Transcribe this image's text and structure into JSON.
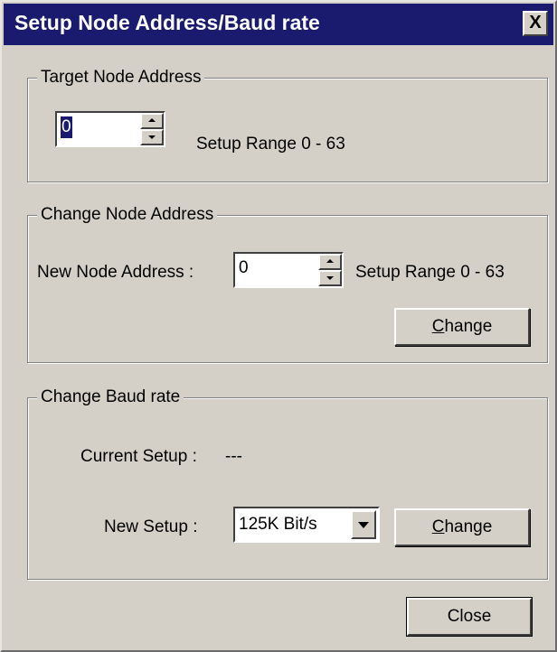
{
  "window": {
    "title": "Setup Node Address/Baud rate",
    "close_glyph": "X",
    "title_bar_color": "#1a1a6e",
    "background_color": "#d4d0c8"
  },
  "target_node": {
    "legend": "Target Node Address",
    "value": "0",
    "range_text": "Setup Range 0 - 63"
  },
  "change_node": {
    "legend": "Change Node Address",
    "new_label": "New Node Address :",
    "value": "0",
    "range_text": "Setup Range 0 - 63",
    "button_label_accel": "C",
    "button_label_rest": "hange"
  },
  "baud": {
    "legend": "Change Baud rate",
    "current_label": "Current Setup :",
    "current_value": "---",
    "new_label": "New Setup :",
    "selected": "125K Bit/s",
    "button_label_accel": "C",
    "button_label_rest": "hange"
  },
  "footer": {
    "close_label": "Close"
  },
  "icons": {
    "spin_up": "chevron-up-icon",
    "spin_down": "chevron-down-icon",
    "dropdown": "dropdown-arrow-icon",
    "close": "close-icon"
  }
}
